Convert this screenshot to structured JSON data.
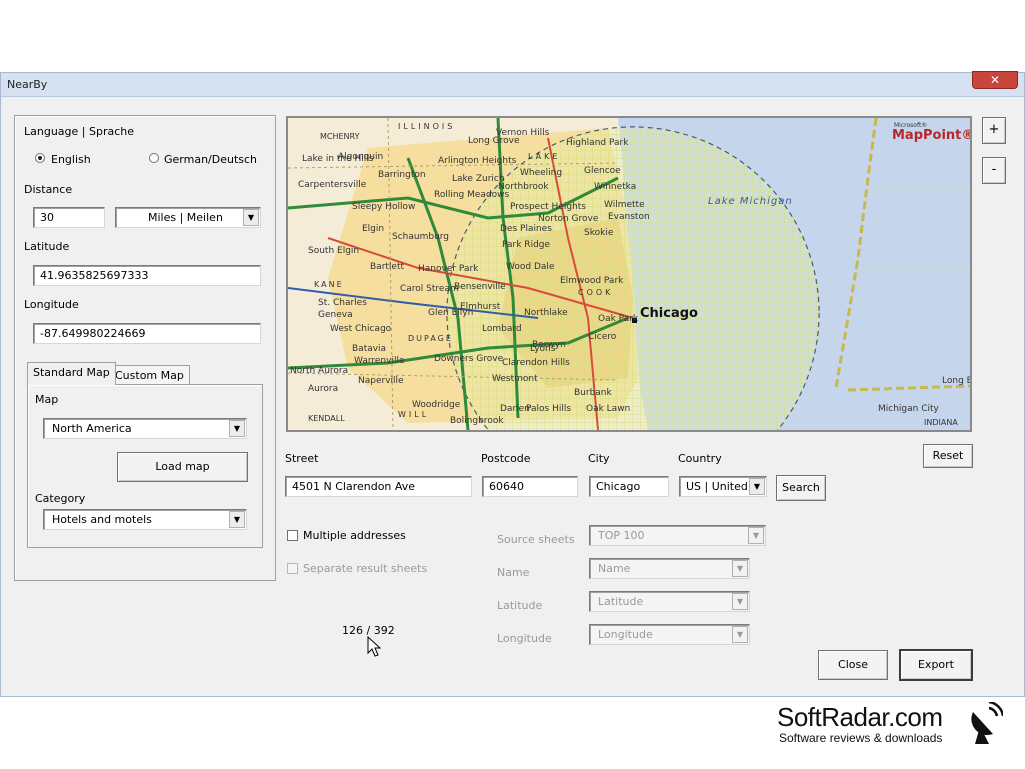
{
  "window": {
    "title": "NearBy",
    "close_glyph": "✕"
  },
  "language": {
    "label": "Language | Sprache",
    "options": [
      "English",
      "German/Deutsch"
    ],
    "selected": "English"
  },
  "distance": {
    "label": "Distance",
    "value": "30",
    "unit": "Miles | Meilen"
  },
  "latitude": {
    "label": "Latitude",
    "value": "41.9635825697333"
  },
  "longitude": {
    "label": "Longitude",
    "value": "-87.649980224669"
  },
  "tabs": {
    "standard": "Standard Map",
    "custom": "Custom Map"
  },
  "map_panel": {
    "map_label": "Map",
    "map_value": "North America",
    "load_button": "Load map",
    "category_label": "Category",
    "category_value": "Hotels and motels"
  },
  "map_view": {
    "brand_small": "Microsoft®",
    "brand": "MapPoint®",
    "city": "Chicago",
    "lake": "Lake Michigan",
    "places": [
      "MCHENRY",
      "ILLINOIS",
      "LAKE",
      "COOK",
      "KANE",
      "DUPAGE",
      "WILL",
      "KENDALL",
      "INDIANA",
      "Vernon Hills",
      "Highland Park",
      "Glencoe",
      "Winnetka",
      "Wilmette",
      "Evanston",
      "Skokie",
      "Northbrook",
      "Wheeling",
      "Prospect Heights",
      "Arlington Heights",
      "Barrington",
      "Algonquin",
      "Lake in the Hills",
      "Carpentersville",
      "Sleepy Hollow",
      "Rolling Meadows",
      "Schaumburg",
      "Elgin",
      "South Elgin",
      "Bartlett",
      "Hanover Park",
      "Des Plaines",
      "Park Ridge",
      "Norton Grove",
      "Carol Stream",
      "Bensenville",
      "Elmhurst",
      "St. Charles",
      "Geneva",
      "West Chicago",
      "Glen Ellyn",
      "Lombard",
      "Batavia",
      "Warrenville",
      "North Aurora",
      "Aurora",
      "Naperville",
      "Downers Grove",
      "Woodridge",
      "Bolingbrook",
      "Westmont",
      "Darien",
      "Palos Hills",
      "Oak Lawn",
      "Burbank",
      "Berwyn",
      "Cicero",
      "Oak Park",
      "Northlake",
      "Elmwood Park",
      "Wood Dale",
      "Clarendon Hills",
      "Lyons",
      "Long Beach",
      "Michigan City",
      "Long Grove",
      "Lake Zurich"
    ],
    "zoom_in": "+",
    "zoom_out": "-"
  },
  "address": {
    "street_label": "Street",
    "street_value": "4501 N Clarendon Ave",
    "postcode_label": "Postcode",
    "postcode_value": "60640",
    "city_label": "City",
    "city_value": "Chicago",
    "country_label": "Country",
    "country_value": "US | United",
    "search_button": "Search",
    "reset_button": "Reset"
  },
  "multi": {
    "multiple_label": "Multiple addresses",
    "separate_label": "Separate result sheets",
    "source_label": "Source sheets",
    "source_value": "TOP 100",
    "name_label": "Name",
    "name_value": "Name",
    "lat_label": "Latitude",
    "lat_value": "Latitude",
    "lon_label": "Longitude",
    "lon_value": "Longitude"
  },
  "counter": "126 / 392",
  "footer": {
    "close_button": "Close",
    "export_button": "Export"
  },
  "watermark": {
    "brand": "SoftRadar.com",
    "tagline": "Software reviews & downloads"
  }
}
